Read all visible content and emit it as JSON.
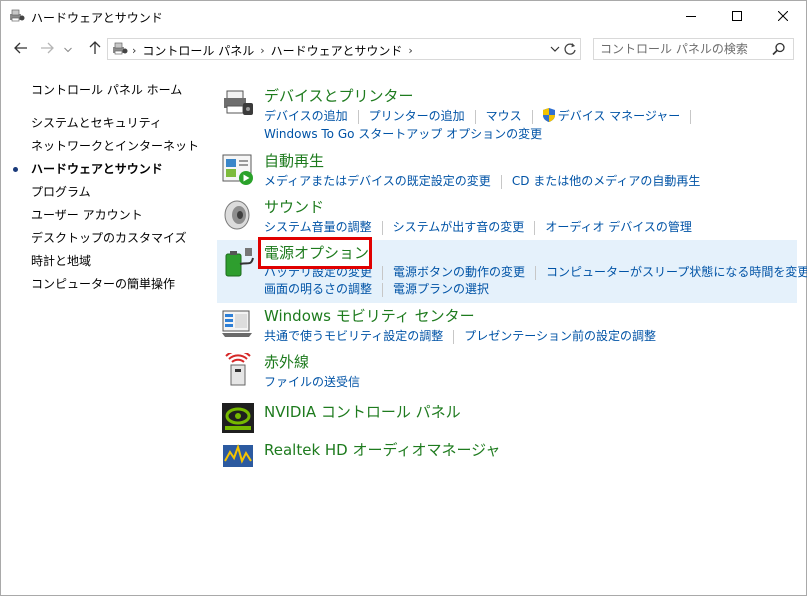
{
  "window": {
    "title": "ハードウェアとサウンド",
    "controls": {
      "minimize": "minimize-icon",
      "maximize": "maximize-icon",
      "close": "close-icon"
    }
  },
  "address": {
    "crumbs": [
      "コントロール パネル",
      "ハードウェアとサウンド"
    ]
  },
  "search": {
    "placeholder": "コントロール パネルの検索"
  },
  "leftnav": {
    "home": "コントロール パネル ホーム",
    "items": [
      "システムとセキュリティ",
      "ネットワークとインターネット",
      "ハードウェアとサウンド",
      "プログラム",
      "ユーザー アカウント",
      "デスクトップのカスタマイズ",
      "時計と地域",
      "コンピューターの簡単操作"
    ]
  },
  "categories": {
    "devices": {
      "title": "デバイスとプリンター",
      "links": [
        "デバイスの追加",
        "プリンターの追加",
        "マウス",
        "デバイス マネージャー",
        "Windows To Go スタートアップ オプションの変更"
      ]
    },
    "autoplay": {
      "title": "自動再生",
      "links": [
        "メディアまたはデバイスの既定設定の変更",
        "CD または他のメディアの自動再生"
      ]
    },
    "sound": {
      "title": "サウンド",
      "links": [
        "システム音量の調整",
        "システムが出す音の変更",
        "オーディオ デバイスの管理"
      ]
    },
    "power": {
      "title": "電源オプション",
      "links": [
        "バッテリ設定の変更",
        "電源ボタンの動作の変更",
        "コンピューターがスリープ状態になる時間を変更",
        "画面の明るさの調整",
        "電源プランの選択"
      ]
    },
    "mobility": {
      "title": "Windows モビリティ センター",
      "links": [
        "共通で使うモビリティ設定の調整",
        "プレゼンテーション前の設定の調整"
      ]
    },
    "infrared": {
      "title": "赤外線",
      "links": [
        "ファイルの送受信"
      ]
    },
    "nvidia": {
      "title": "NVIDIA コントロール パネル"
    },
    "realtek": {
      "title": "Realtek HD オーディオマネージャ"
    }
  },
  "colors": {
    "category_title": "#1e7b1e",
    "link": "#0053a6",
    "highlight_bg": "#e5f1fb",
    "annotation_box": "#e00000"
  }
}
